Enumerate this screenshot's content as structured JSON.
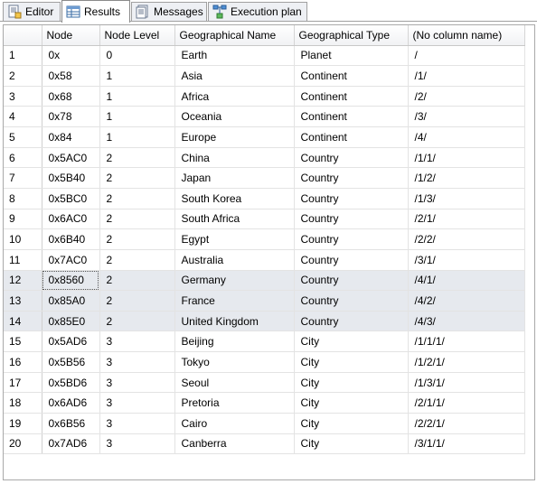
{
  "tabs": [
    {
      "label": "Editor",
      "icon": "editor-icon"
    },
    {
      "label": "Results",
      "icon": "results-grid-icon"
    },
    {
      "label": "Messages",
      "icon": "messages-icon"
    },
    {
      "label": "Execution plan",
      "icon": "execution-plan-icon"
    }
  ],
  "active_tab": "Results",
  "grid": {
    "columns": [
      "Node",
      "Node Level",
      "Geographical Name",
      "Geographical Type",
      "(No column name)"
    ],
    "rows": [
      {
        "num": "1",
        "cells": [
          "0x",
          "0",
          "Earth",
          "Planet",
          "/"
        ]
      },
      {
        "num": "2",
        "cells": [
          "0x58",
          "1",
          "Asia",
          "Continent",
          "/1/"
        ]
      },
      {
        "num": "3",
        "cells": [
          "0x68",
          "1",
          "Africa",
          "Continent",
          "/2/"
        ]
      },
      {
        "num": "4",
        "cells": [
          "0x78",
          "1",
          "Oceania",
          "Continent",
          "/3/"
        ]
      },
      {
        "num": "5",
        "cells": [
          "0x84",
          "1",
          "Europe",
          "Continent",
          "/4/"
        ]
      },
      {
        "num": "6",
        "cells": [
          "0x5AC0",
          "2",
          "China",
          "Country",
          "/1/1/"
        ]
      },
      {
        "num": "7",
        "cells": [
          "0x5B40",
          "2",
          "Japan",
          "Country",
          "/1/2/"
        ]
      },
      {
        "num": "8",
        "cells": [
          "0x5BC0",
          "2",
          "South Korea",
          "Country",
          "/1/3/"
        ]
      },
      {
        "num": "9",
        "cells": [
          "0x6AC0",
          "2",
          "South Africa",
          "Country",
          "/2/1/"
        ]
      },
      {
        "num": "10",
        "cells": [
          "0x6B40",
          "2",
          "Egypt",
          "Country",
          "/2/2/"
        ]
      },
      {
        "num": "11",
        "cells": [
          "0x7AC0",
          "2",
          "Australia",
          "Country",
          "/3/1/"
        ]
      },
      {
        "num": "12",
        "cells": [
          "0x8560",
          "2",
          "Germany",
          "Country",
          "/4/1/"
        ]
      },
      {
        "num": "13",
        "cells": [
          "0x85A0",
          "2",
          "France",
          "Country",
          "/4/2/"
        ]
      },
      {
        "num": "14",
        "cells": [
          "0x85E0",
          "2",
          "United Kingdom",
          "Country",
          "/4/3/"
        ]
      },
      {
        "num": "15",
        "cells": [
          "0x5AD6",
          "3",
          "Beijing",
          "City",
          "/1/1/1/"
        ]
      },
      {
        "num": "16",
        "cells": [
          "0x5B56",
          "3",
          "Tokyo",
          "City",
          "/1/2/1/"
        ]
      },
      {
        "num": "17",
        "cells": [
          "0x5BD6",
          "3",
          "Seoul",
          "City",
          "/1/3/1/"
        ]
      },
      {
        "num": "18",
        "cells": [
          "0x6AD6",
          "3",
          "Pretoria",
          "City",
          "/2/1/1/"
        ]
      },
      {
        "num": "19",
        "cells": [
          "0x6B56",
          "3",
          "Cairo",
          "City",
          "/2/2/1/"
        ]
      },
      {
        "num": "20",
        "cells": [
          "0x7AD6",
          "3",
          "Canberra",
          "City",
          "/3/1/1/"
        ]
      }
    ],
    "selected_rows": [
      "12",
      "13",
      "14"
    ],
    "focused_cell": {
      "row": "12",
      "column": "Node"
    }
  },
  "colors": {
    "selection": "#e6e9ee",
    "grid_border": "#e3e3e3",
    "header_bg": "#f1f2f4"
  }
}
